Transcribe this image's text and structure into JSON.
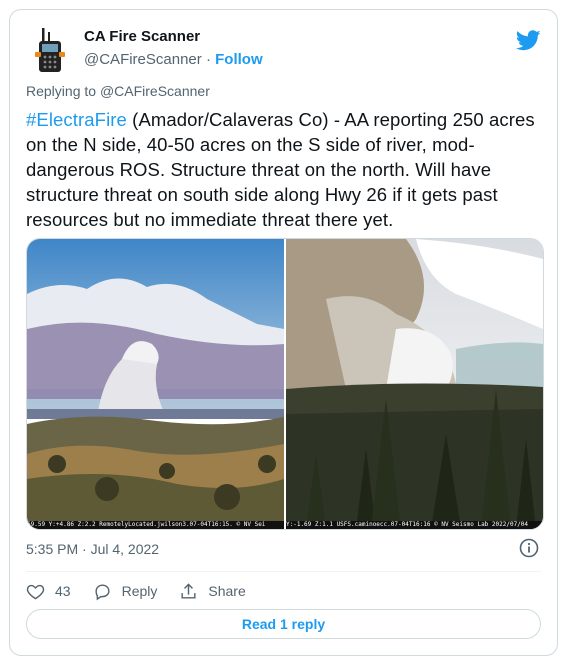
{
  "author": {
    "name": "CA Fire Scanner",
    "handle": "@CAFireScanner",
    "separator": " · ",
    "follow_label": "Follow",
    "avatar_icon": "radio-scanner-icon"
  },
  "reply_to": {
    "prefix": "Replying to ",
    "handle": "@CAFireScanner"
  },
  "tweet": {
    "hashtag": "#ElectraFire",
    "body": " (Amador/Calaveras Co) - AA reporting 250 acres on the N side, 40-50 acres on the S side of river, mod-dangerous ROS. Structure threat on the north. Will have structure threat on south side along Hwy 26 if it gets past resources but no immediate threat there yet."
  },
  "media": {
    "left_caption": "69.59 Y:+4.86 Z:2.2 RemotelyLocated.jwilson3.07-04T16:15. © NV Sei",
    "right_caption": "Y:-1.69 Z:1.1 USFS.caminoecc.07-04T16:16 © NV Seismo Lab 2022/07/04"
  },
  "meta": {
    "timestamp": "5:35 PM · Jul 4, 2022"
  },
  "actions": {
    "like_count": "43",
    "reply_label": "Reply",
    "share_label": "Share"
  },
  "read_replies_label": "Read 1 reply",
  "colors": {
    "accent": "#1d9bf0",
    "secondary_text": "#536471",
    "border": "#cfd9de"
  }
}
